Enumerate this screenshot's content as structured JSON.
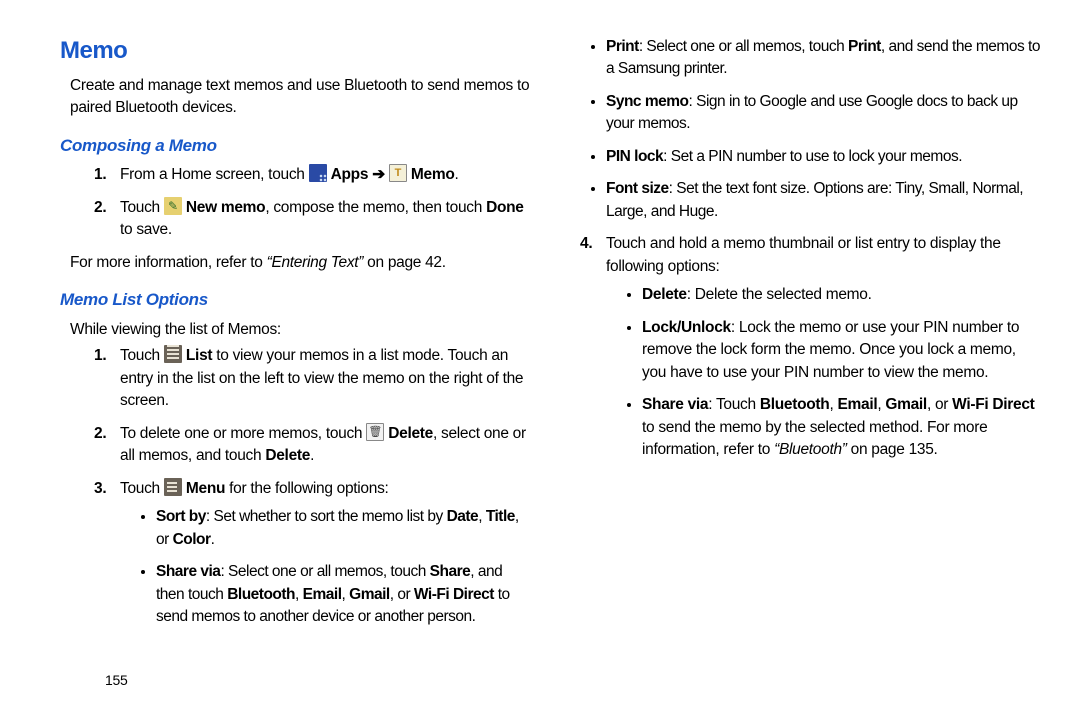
{
  "page_number": "155",
  "h1": "Memo",
  "intro": "Create and manage text memos and use Bluetooth to send memos to paired Bluetooth devices.",
  "sec1": {
    "title": "Composing a Memo",
    "step1_pre": "From a Home screen, touch ",
    "apps_bold": " Apps ",
    "arrow": "➔",
    "memo_bold": " Memo",
    "step1_post": ".",
    "step2_pre": "Touch ",
    "newmemo_bold": " New memo",
    "step2_mid": ", compose the memo, then touch ",
    "done_bold": "Done",
    "step2_post": " to save.",
    "refer_pre": "For more information, refer to ",
    "refer_link": "“Entering Text”",
    "refer_post": "  on page 42."
  },
  "sec2": {
    "title": "Memo List Options",
    "intro": "While viewing the list of Memos:",
    "s1_pre": "Touch ",
    "s1_list_bold": " List",
    "s1_post": " to view your memos in a list mode. Touch an entry in the list on the left to view the memo on the right of the screen.",
    "s2_pre": "To delete one or more memos, touch ",
    "s2_delete_bold": " Delete",
    "s2_mid": ", select one or all memos, and touch ",
    "s2_delete2_bold": "Delete",
    "s2_post": ".",
    "s3_pre": "Touch ",
    "s3_menu_bold": " Menu",
    "s3_post": " for the following options:",
    "b1_pre": "Sort by",
    "b1_mid": ": Set whether to sort the memo list by ",
    "b1_date": "Date",
    "b1_c1": ", ",
    "b1_title": "Title",
    "b1_c2": ", or ",
    "b1_color": "Color",
    "b1_post": ".",
    "b2_pre": "Share via",
    "b2_mid": ": Select one or all memos, touch ",
    "b2_share": "Share",
    "b2_then": ", and then touch ",
    "b2_bt": "Bluetooth",
    "b2_c1": ", ",
    "b2_email": "Email",
    "b2_c2": ", ",
    "b2_gmail": "Gmail",
    "b2_c3": ", or ",
    "b2_wifi": "Wi-Fi Direct",
    "b2_post": " to send memos to another device or another person."
  },
  "right": {
    "b_print_b": "Print",
    "b_print_mid": ": Select one or all memos, touch ",
    "b_print_b2": "Print",
    "b_print_post": ", and send the memos to a Samsung printer.",
    "b_sync_b": "Sync memo",
    "b_sync_post": ": Sign in to Google and use Google docs to back up your memos.",
    "b_pin_b": "PIN lock",
    "b_pin_post": ": Set a PIN number to use to lock your memos.",
    "b_font_b": "Font size",
    "b_font_post": ": Set the text font size. Options are: Tiny, Small, Normal, Large, and Huge.",
    "s4": "Touch and hold a memo thumbnail or list entry to display the following options:",
    "d_del_b": "Delete",
    "d_del_post": ": Delete the selected memo.",
    "d_lock_b": "Lock/Unlock",
    "d_lock_post": ": Lock the memo or use your PIN number to remove the lock form the memo. Once you lock a memo, you have to use your PIN number to view the memo.",
    "d_share_b": "Share via",
    "d_share_mid": ": Touch ",
    "d_share_bt": "Bluetooth",
    "d_c1": ", ",
    "d_share_email": "Email",
    "d_c2": ", ",
    "d_share_gmail": "Gmail",
    "d_c3": ", or ",
    "d_share_wifi": "Wi-Fi Direct",
    "d_share_post": " to send the memo by the selected method. For more information, refer to ",
    "d_share_ref": "“Bluetooth”",
    "d_share_pg": "  on page 135."
  }
}
